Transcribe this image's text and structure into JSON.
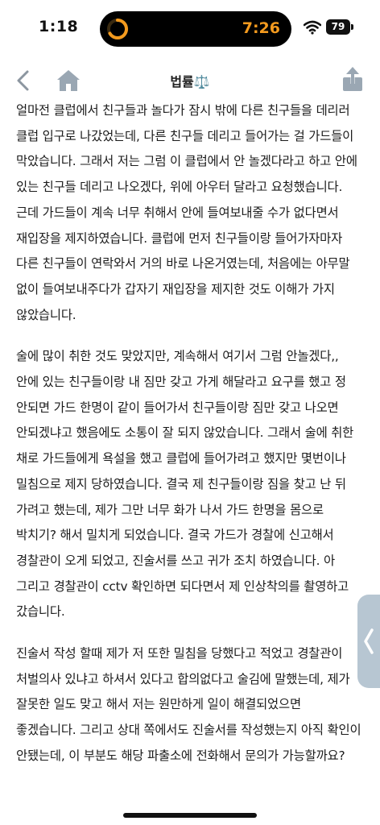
{
  "status_bar": {
    "time": "1:18",
    "island_timer": "7:26",
    "battery": "79"
  },
  "nav": {
    "title": "법률⚖️"
  },
  "content": {
    "paragraphs": [
      "얼마전 클럽에서 친구들과 놀다가 잠시 밖에 다른 친구들을 데리러 클럽 입구로 나갔었는데, 다른 친구들 데리고 들어가는 걸 가드들이 막았습니다. 그래서 저는 그럼 이 클럽에서 안 놀겠다라고 하고 안에 있는 친구들 데리고 나오겠다, 위에 아우터 달라고 요청했습니다. 근데 가드들이 계속 너무 취해서 안에 들여보내줄 수가 없다면서 재입장을 제지하였습니다. 클럽에 먼저 친구들이랑 들어가자마자 다른 친구들이 연락와서 거의 바로 나온거였는데, 처음에는 아무말 없이 들여보내주다가 갑자기 재입장을 제지한 것도 이해가 가지 않았습니다.",
      "술에 많이 취한 것도 맞았지만, 계속해서 여기서 그럼 안놀겠다,, 안에 있는 친구들이랑 내 짐만 갖고 가게 해달라고 요구를 했고 정 안되면 가드 한명이 같이 들어가서 친구들이랑 짐만 갖고 나오면 안되겠냐고 했음에도 소통이 잘 되지 않았습니다. 그래서 술에 취한 채로 가드들에게 욕설을 했고 클럽에 들어가려고 했지만 몇번이나 밀침으로 제지 당하였습니다. 결국 제 친구들이랑 짐을 찾고 난 뒤 가려고 했는데, 제가 그만 너무 화가 나서 가드 한명을 몸으로 박치기? 해서 밀치게 되었습니다. 결국 가드가 경찰에 신고해서 경찰관이 오게 되었고, 진술서를 쓰고 귀가 조치 하였습니다. 아 그리고 경찰관이 cctv 확인하면 되다면서 제 인상착의를 촬영하고 갔습니다.",
      "진술서 작성 할때 제가 저 또한 밀침을 당했다고 적었고 경찰관이 처벌의사 있냐고 하셔서 있다고 합의없다고 술김에 말했는데, 제가 잘못한 일도 맞고 해서 저는 원만하게 일이 해결되었으면 좋겠습니다. 그리고 상대 쪽에서도 진술서를 작성했는지 아직 확인이 안됐는데, 이 부분도 해당 파출소에 전화해서 문의가 가능할까요?"
    ]
  },
  "icons": {
    "back": "chevron-left-icon",
    "home": "home-icon",
    "share": "share-icon",
    "side_handle": "chevron-left-icon"
  },
  "colors": {
    "accent_gray": "#9aa7b3",
    "island_timer": "#f39a1e",
    "side_handle": "#b7c6d2"
  }
}
